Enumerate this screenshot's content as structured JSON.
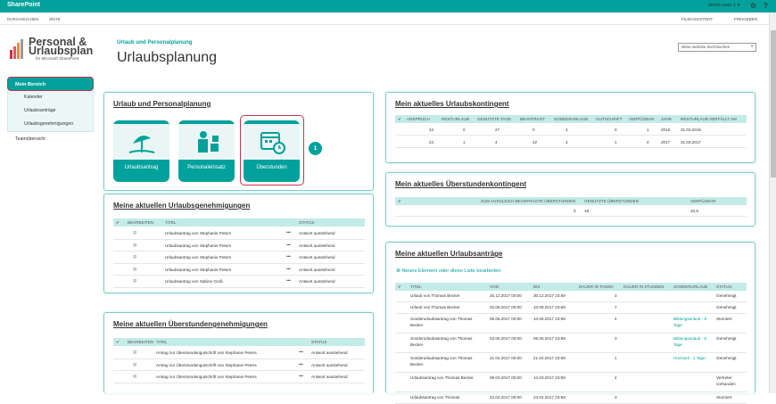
{
  "topbar": {
    "brand": "SharePoint",
    "user": "demo-user-1 ▾",
    "gear": "⚙",
    "help": "?"
  },
  "ribbon": {
    "browse": "DURCHSUCHEN",
    "page": "SEITE",
    "wizard": "FILMASSISTENT",
    "share": "FREIGEBEN"
  },
  "logo": {
    "line1": "Personal &",
    "line2": "Urlaubsplan",
    "line3": "for Microsoft SharePoint"
  },
  "header": {
    "breadcrumb": "Urlaub und Personalplanung",
    "title": "Urlaubsplanung"
  },
  "search": {
    "placeholder": "diese website durchsuchen"
  },
  "nav": {
    "main": "Mein Bereich",
    "items": [
      "Kalender",
      "Urlaubsanträge",
      "Urlaubsgenehmigungen"
    ],
    "team": "Teamübersicht"
  },
  "urlaub": {
    "title": "Urlaub und Personalplanung",
    "tiles": [
      "Urlaubsantrag",
      "Personaleinsatz",
      "Überstunden"
    ],
    "badge": "1"
  },
  "genehmigungen": {
    "title": "Meine aktuellen Urlaubsgenehmigungen",
    "headers": [
      "✔",
      "BEARBEITEN",
      "TITEL",
      "STATUS"
    ],
    "rows": [
      {
        "title": "Urlaubsantrag von Stephanie Peters",
        "status": "Antwort ausstehend"
      },
      {
        "title": "Urlaubsantrag von Stephanie Peters",
        "status": "Antwort ausstehend"
      },
      {
        "title": "Urlaubsantrag von Stephanie Peters",
        "status": "Antwort ausstehend"
      },
      {
        "title": "Urlaubsantrag von Stephanie Peters",
        "status": "Antwort ausstehend"
      },
      {
        "title": "Urlaubsantrag von Sabine Groß",
        "status": "Antwort ausstehend"
      }
    ]
  },
  "ueberstundengen": {
    "title": "Meine aktuellen Überstundengenehmigungen",
    "headers": [
      "✔",
      "BEARBEITEN",
      "TITEL",
      "STATUS"
    ],
    "rows": [
      {
        "title": "Antrag zur Überstundengutschrift von Stephanie Peters",
        "status": "Antwort ausstehend"
      },
      {
        "title": "Antrag zur Überstundengutschrift von Stephanie Peters",
        "status": "Antwort ausstehend"
      },
      {
        "title": "Antrag zur Überstundengutschrift von Stephanie Peters",
        "status": "Antwort ausstehend"
      }
    ]
  },
  "kontingent": {
    "title": "Mein aktuelles Urlaubskontingent",
    "headers": [
      "✔",
      "ANSPRUCH",
      "RESTURLAUB",
      "GENUTZTE TAGE",
      "BEANTRAGT",
      "SONDERURLAUB",
      "GUTSCHRIFT",
      "VERFÜGBAR",
      "JAHR",
      "RESTURLAUB VERFÄLLT AM"
    ],
    "rows": [
      [
        "24",
        "0",
        "27",
        "0",
        "4",
        "0",
        "1",
        "2016",
        "31.03.2016"
      ],
      [
        "24",
        "1",
        "4",
        "22",
        "4",
        "1",
        "4",
        "2017",
        "31.03.2017"
      ]
    ]
  },
  "ueberkontingent": {
    "title": "Mein aktuelles Überstundenkontingent",
    "headers": [
      "✔",
      "ZUM AUSGLEICH BEANTRAGTE ÜBERSTUNDEN",
      "GENUTZTE ÜBERSTUNDEN",
      "VERFÜGBAR"
    ],
    "row": [
      "0",
      "18",
      "10,5"
    ]
  },
  "antraege": {
    "title": "Meine aktuellen Urlaubsanträge",
    "newitem": "Neues Element oder diese Liste bearbeiten",
    "headers": [
      "✔",
      "TITEL",
      "VON",
      "BIS",
      "DAUER IN TAGEN",
      "DAUER IN STUNDEN",
      "SONDERURLAUB",
      "STATUS"
    ],
    "rows": [
      {
        "title": "Urlaub von Thomas Becker",
        "von": "25.12.2017 00:00",
        "bis": "30.12.2017 23:59",
        "tage": "3",
        "sonder": "",
        "status": "Genehmigt"
      },
      {
        "title": "Urlaub von Thomas Becker",
        "von": "02.08.2017 00:00",
        "bis": "10.08.2017 23:59",
        "tage": "7",
        "sonder": "",
        "status": "Genehmigt"
      },
      {
        "title": "Sonderurlaubsantrag von Thomas Becker",
        "von": "05.06.2017 00:00",
        "bis": "10.06.2017 23:59",
        "tage": "4",
        "sonder": "Bildungsurlaub - 5 Tage",
        "status": "Storniert"
      },
      {
        "title": "Sonderurlaubsantrag von Thomas Becker",
        "von": "03.05.2017 00:00",
        "bis": "05.05.2017 23:59",
        "tage": "3",
        "sonder": "Bildungsurlaub - 5 Tage",
        "status": "Genehmigt"
      },
      {
        "title": "Sonderurlaubsantrag von Thomas Becker",
        "von": "21.04.2017 00:00",
        "bis": "21.04.2017 23:59",
        "tage": "1",
        "sonder": "Hochzeit - 1 Tage",
        "status": "Genehmigt"
      },
      {
        "title": "Urlaubsantrag von Thomas Becker",
        "von": "09.03.2017 00:00",
        "bis": "14.03.2017 23:59",
        "tage": "4",
        "sonder": "",
        "status": "Vertreter vorhanden"
      },
      {
        "title": "Urlaubsantrag von Thomas",
        "von": "22.02.2017 00:00",
        "bis": "24.02.2017 23:59",
        "tage": "3",
        "sonder": "",
        "status": "Storniert"
      }
    ]
  }
}
